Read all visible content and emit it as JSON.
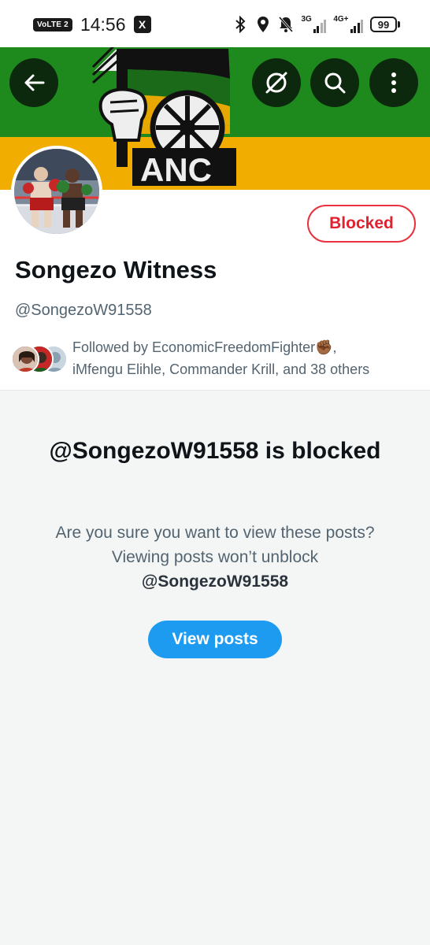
{
  "status_bar": {
    "volte_label": "VoLTE",
    "sim_slot": "2",
    "time": "14:56",
    "x_badge": "X",
    "network_1": "3G",
    "network_2": "4G+",
    "battery_level": "99",
    "icons": [
      "bluetooth-icon",
      "location-icon",
      "mute-icon"
    ]
  },
  "header": {
    "banner_text": "ANC",
    "buttons": [
      "back-arrow-icon",
      "grok-icon",
      "search-icon",
      "more-vertical-icon"
    ],
    "colors": {
      "banner_green": "#1e8a1e",
      "banner_gold": "#f2ae00"
    }
  },
  "profile": {
    "blocked_label": "Blocked",
    "name": "Songezo Witness",
    "handle": "@SongezoW91558",
    "followed_by_line1": "Followed by EconomicFreedomFighter✊🏾,",
    "followed_by_line2": "iMfengu Elihle, Commander Krill, and 38 others"
  },
  "blocked_notice": {
    "title": "@SongezoW91558 is blocked",
    "body": "Are you sure you want to view these posts? Viewing posts won’t unblock",
    "body_handle": "@SongezoW91558",
    "view_button": "View posts",
    "colors": {
      "accent": "#1d9bf0",
      "blocked_red": "#e0212f"
    }
  }
}
